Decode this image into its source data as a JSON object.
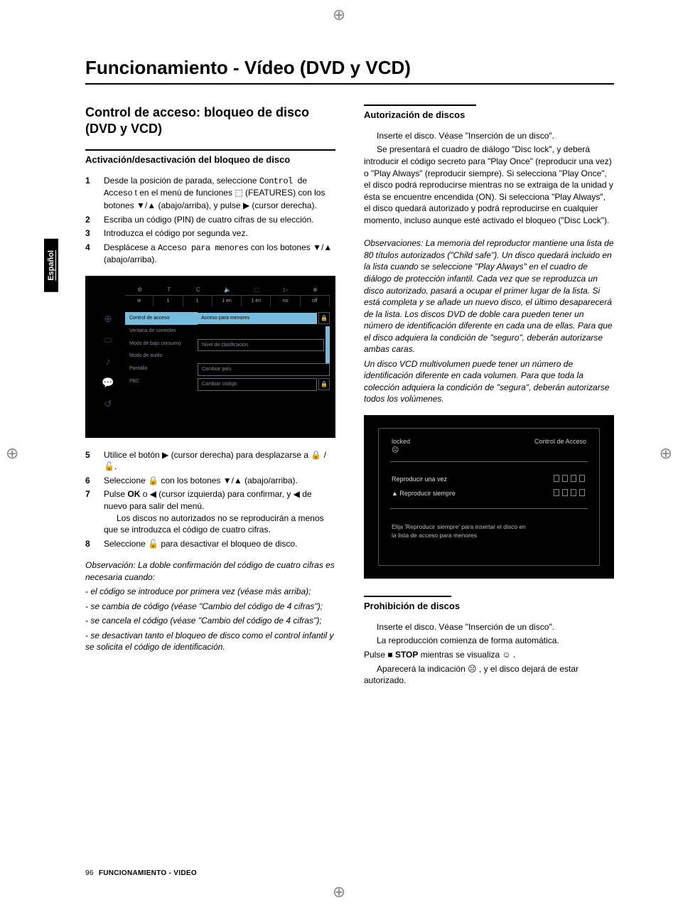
{
  "page_title": "Funcionamiento - Vídeo (DVD y VCD)",
  "language_tab": "Español",
  "left": {
    "section_title": "Control de acceso: bloqueo de disco (DVD y VCD)",
    "sub1": "Activación/desactivación del bloqueo de disco",
    "steps_a": [
      {
        "n": "1",
        "t": "Desde la posición de parada, seleccione ",
        "ui": "Control de Acceso",
        "t2": " t en el menú de funciones ",
        "t3": " (FEATURES) con los botones ▼/▲ (abajo/arriba), y pulse ▶ (cursor derecha)."
      },
      {
        "n": "2",
        "t": "Escriba un código (PIN) de cuatro cifras de su elección."
      },
      {
        "n": "3",
        "t": "Introduzca el código por segunda vez."
      },
      {
        "n": "4",
        "t": "Desplácese a ",
        "ui": "Acceso para menores",
        "t2": " con los botones ▼/▲ (abajo/arriba)."
      }
    ],
    "menu_screenshot": {
      "top_icons": [
        "⚙",
        "T",
        "C",
        "🔈",
        "⬚",
        "▷",
        "⊕"
      ],
      "top_vals": [
        "1",
        "1",
        "1 en",
        "1 en",
        "no",
        "off"
      ],
      "side_icons": [
        "⊕",
        "⬭",
        "♪",
        "💬",
        "↺"
      ],
      "menu_items": [
        "Control de acceso",
        "Ventana de controles",
        "Modo de bajo consumo",
        "Modo de audio",
        "Pantalla",
        "PBC"
      ],
      "sub_items": [
        "Acceso para menores",
        "Nivel de clasificación",
        "Cambiar país",
        "Cambiar código"
      ]
    },
    "steps_b": [
      {
        "n": "5",
        "t": "Utilice el botón ▶ (cursor derecha) para desplazarse a 🔒 / 🔓."
      },
      {
        "n": "6",
        "t": "Seleccione 🔒 con los botones ▼/▲ (abajo/arriba)."
      },
      {
        "n": "7",
        "t": "Pulse ",
        "b": "OK",
        "t2": " o ◀ (cursor izquierda) para confirmar, y ◀ de nuevo para salir del menú.",
        "extra": "Los discos no autorizados no se reproducirán a menos que se introduzca el código de cuatro cifras."
      },
      {
        "n": "8",
        "t": "Seleccione 🔓 para desactivar el bloqueo de disco."
      }
    ],
    "note_intro": "Observación: La doble confirmación del código de cuatro cifras es necesaria cuando:",
    "note_items": [
      "- el código se introduce por primera vez (véase más arriba);",
      "- se cambia de código (véase \"Cambio del código de 4 cifras\");",
      "- se cancela el código (véase \"Cambio del código de 4 cifras\");",
      "- se desactivan tanto el bloqueo de disco como el control infantil y se solicita el código de identificación."
    ]
  },
  "right": {
    "sub1": "Autorización de discos",
    "p1": "Inserte el disco. Véase \"Inserción de un disco\".",
    "p2": "Se presentará el cuadro de diálogo \"Disc lock\", y deberá introducir el código secreto para \"Play Once\" (reproducir una vez) o \"Play Always\" (reproducir siempre). Si selecciona \"Play Once\", el disco podrá reproducirse mientras no se extraiga de la unidad y ésta se encuentre encendida (ON). Si selecciona \"Play Always\", el disco quedará autorizado y podrá reproducirse en cualquier momento, incluso aunque esté activado el bloqueo (\"Disc Lock\").",
    "obs1": "Observaciones: La memoria del reproductor mantiene una lista de 80 títulos autorizados (\"Child safe\"). Un disco quedará incluido en la lista cuando se seleccione \"Play Always\" en el cuadro de diálogo de protección infantil. Cada vez que se reproduzca un disco autorizado, pasará a ocupar el primer lugar de la lista. Si está completa y se añade un nuevo disco, el último desaparecerá de la lista. Los discos DVD de doble cara pueden tener un número de identificación diferente en cada una de ellas. Para que el disco adquiera la condición de \"seguro\", deberán autorizarse ambas caras.",
    "obs2": "Un disco VCD multivolumen puede tener un número de identificación diferente en cada volumen. Para que toda la colección adquiera la condición de \"segura\", deberán autorizarse todos los volúmenes.",
    "dialog": {
      "locked": "locked",
      "title": "Control de Acceso",
      "opt1": "Reproducir una vez",
      "opt2": "▲  Reproducir siempre",
      "msg1": "Elija 'Reproducir siempre' para insertar el disco en",
      "msg2": "la lista de acceso para menores"
    },
    "sub2": "Prohibición de discos",
    "p3": "Inserte el disco. Véase \"Inserción de un disco\".",
    "p4": "La reproducción comienza de forma automática.",
    "p5a": "Pulse ■ ",
    "p5b": "STOP",
    "p5c": " mientras se visualiza ☺ .",
    "p6": "Aparecerá la indicación ☹ , y el disco dejará de estar autorizado."
  },
  "footer": {
    "page": "96",
    "label": "FUNCIONAMIENTO - VIDEO"
  }
}
